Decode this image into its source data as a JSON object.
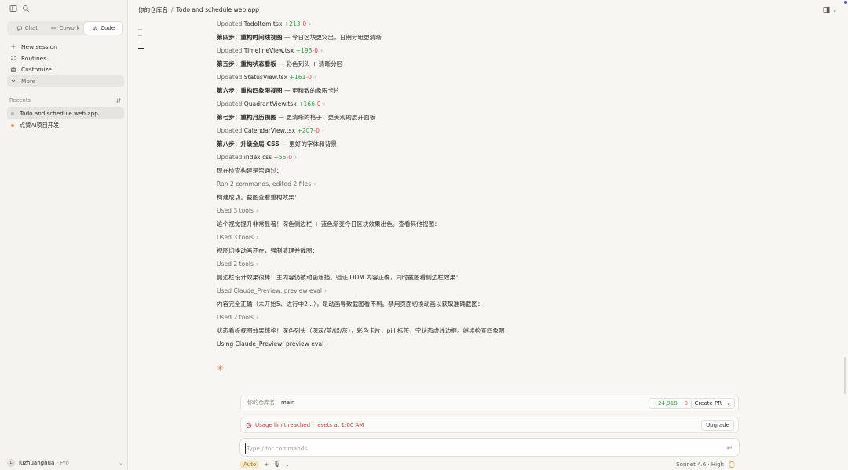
{
  "sidebar": {
    "modes": [
      {
        "label": "Chat",
        "icon": "chat-icon"
      },
      {
        "label": "Cowork",
        "icon": "cowork-icon"
      },
      {
        "label": "Code",
        "icon": "code-icon",
        "active": true
      }
    ],
    "nav": [
      {
        "label": "New session",
        "icon": "plus-icon"
      },
      {
        "label": "Routines",
        "icon": "routines-icon"
      },
      {
        "label": "Customize",
        "icon": "briefcase-icon"
      },
      {
        "label": "More",
        "icon": "chevron-down-icon"
      }
    ],
    "recents_label": "Recents",
    "recents": [
      {
        "label": "Todo and schedule web app",
        "dot_color": "#b8b5ae",
        "selected": true
      },
      {
        "label": "点赞AI项目开发",
        "dot_color": "#c9a227",
        "selected": false
      }
    ],
    "user": {
      "initial": "L",
      "name": "luzhuanghua",
      "plan": "Pro"
    }
  },
  "header": {
    "repo": "你的仓库名",
    "separator": "/",
    "session": "Todo and schedule web app"
  },
  "transcript": {
    "l0": {
      "prefix": "Updated",
      "file": "TodoItem.tsx",
      "plus": "+213",
      "minus": "-0"
    },
    "s4": {
      "bold": "第四步：重构时间线视图",
      "rest": " — 今日区块更突出，日期分组更清晰"
    },
    "l1": {
      "prefix": "Updated",
      "file": "TimelineView.tsx",
      "plus": "+193",
      "minus": "-0"
    },
    "s5": {
      "bold": "第五步：重构状态看板",
      "rest": " — 彩色列头 + 清晰分区"
    },
    "l2": {
      "prefix": "Updated",
      "file": "StatusView.tsx",
      "plus": "+161",
      "minus": "-0"
    },
    "s6": {
      "bold": "第六步：重构四象限视图",
      "rest": " — 更精致的象限卡片"
    },
    "l3": {
      "prefix": "Updated",
      "file": "QuadrantView.tsx",
      "plus": "+166",
      "minus": "-0"
    },
    "s7": {
      "bold": "第七步：重构月历视图",
      "rest": " — 更清晰的格子，更美观的展开面板"
    },
    "l4": {
      "prefix": "Updated",
      "file": "CalendarView.tsx",
      "plus": "+207",
      "minus": "-0"
    },
    "s8": {
      "bold": "第八步：升级全局 CSS",
      "rest": " — 更好的字体和背景"
    },
    "l5": {
      "prefix": "Updated",
      "file": "index.css",
      "plus": "+55",
      "minus": "-0"
    },
    "t1": "现在检查构建是否通过：",
    "a1": "Ran 2 commands, edited 2 files",
    "t2": "构建成功。截图查看重构效果：",
    "a2": "Used 3 tools",
    "t3": "这个视觉提升非常显著！深色侧边栏 + 蓝色渐变今日区块效果出色。查看其他视图：",
    "a3": "Used 3 tools",
    "t4": "视图切换动画还在，强制清理并截图：",
    "a4": "Used 2 tools",
    "t5": "侧边栏设计效果很棒！主内容仍被动画遮挡。验证 DOM 内容正确，同时截图看侧边栏效果：",
    "a5": "Used Claude_Preview: preview eval",
    "t6": "内容完全正确（未开始5、进行中2...），是动画导致截图看不到。禁用页面切换动画以获取准确截图：",
    "a6": "Used 2 tools",
    "t7": "状态看板视图效果惊艳！深色列头（深灰/蓝/绿/灰），彩色卡片，pill 标签，空状态虚线边框。继续检查四象限：",
    "a7": "Using Claude_Preview: preview eval"
  },
  "composer": {
    "repo": "你的仓库名",
    "branch": "main",
    "diff_plus": "+24,918",
    "diff_minus": "−0",
    "create_pr": "Create PR",
    "limit_text": "Usage limit reached · resets at 1:00 AM",
    "upgrade": "Upgrade",
    "placeholder": "Type / for commands",
    "mode": "Auto",
    "model": "Sonnet 4.6 · High"
  },
  "colors": {
    "accent": "#d97757",
    "added": "#2f9e44",
    "removed": "#e5484d",
    "limit": "#c53030"
  }
}
